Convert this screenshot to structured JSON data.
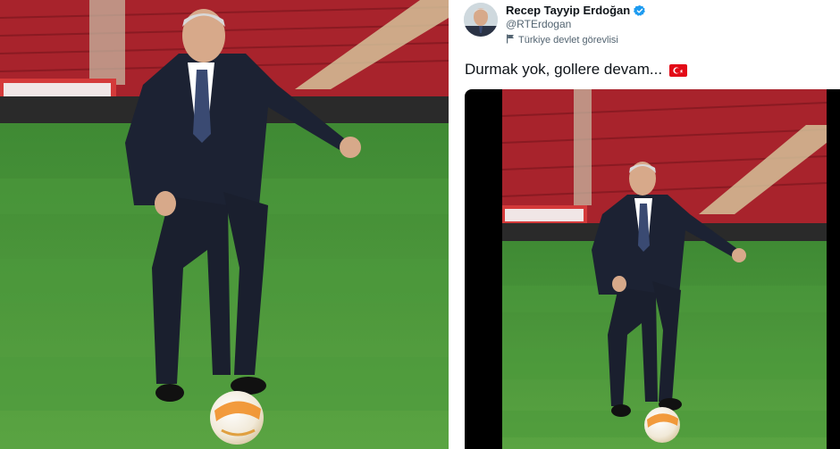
{
  "tweet": {
    "author_name": "Recep Tayyip Erdoğan",
    "handle": "@RTErdogan",
    "account_label": "Türkiye devlet görevlisi",
    "text": "Durmak yok, gollere devam...",
    "flag": "turkey-flag",
    "verified_icon": "verified-badge-icon",
    "label_icon": "flag-label-icon"
  },
  "colors": {
    "verified": "#1d9bf0",
    "turkey_red": "#e30a17",
    "pitch_green": "#4f9a3a",
    "stand_red": "#b32630"
  }
}
